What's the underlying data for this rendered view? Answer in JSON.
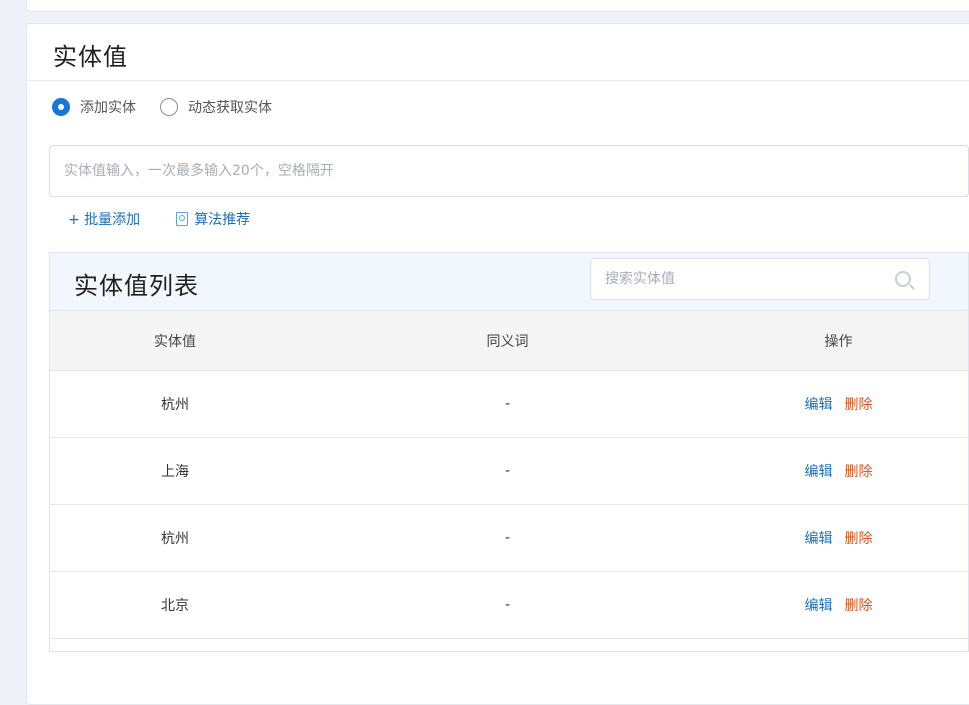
{
  "page": {
    "title": "实体值"
  },
  "mode": {
    "options": [
      {
        "label": "添加实体",
        "checked": true
      },
      {
        "label": "动态获取实体",
        "checked": false
      }
    ]
  },
  "entity_input": {
    "placeholder": "实体值输入，一次最多输入20个，空格隔开",
    "value": ""
  },
  "actions": {
    "batch_add": "+ 批量添加",
    "algorithm_recommend": "算法推荐"
  },
  "list": {
    "title": "实体值列表",
    "search_placeholder": "搜索实体值",
    "columns": [
      "实体值",
      "同义词",
      "操作"
    ],
    "rows": [
      {
        "value": "杭州",
        "synonym": "-",
        "edit": "编辑",
        "delete": "删除"
      },
      {
        "value": "上海",
        "synonym": "-",
        "edit": "编辑",
        "delete": "删除"
      },
      {
        "value": "杭州",
        "synonym": "-",
        "edit": "编辑",
        "delete": "删除"
      },
      {
        "value": "北京",
        "synonym": "-",
        "edit": "编辑",
        "delete": "删除"
      }
    ]
  },
  "colors": {
    "accent": "#1677d9",
    "link": "#1b6fb8",
    "danger": "#d9541e"
  }
}
